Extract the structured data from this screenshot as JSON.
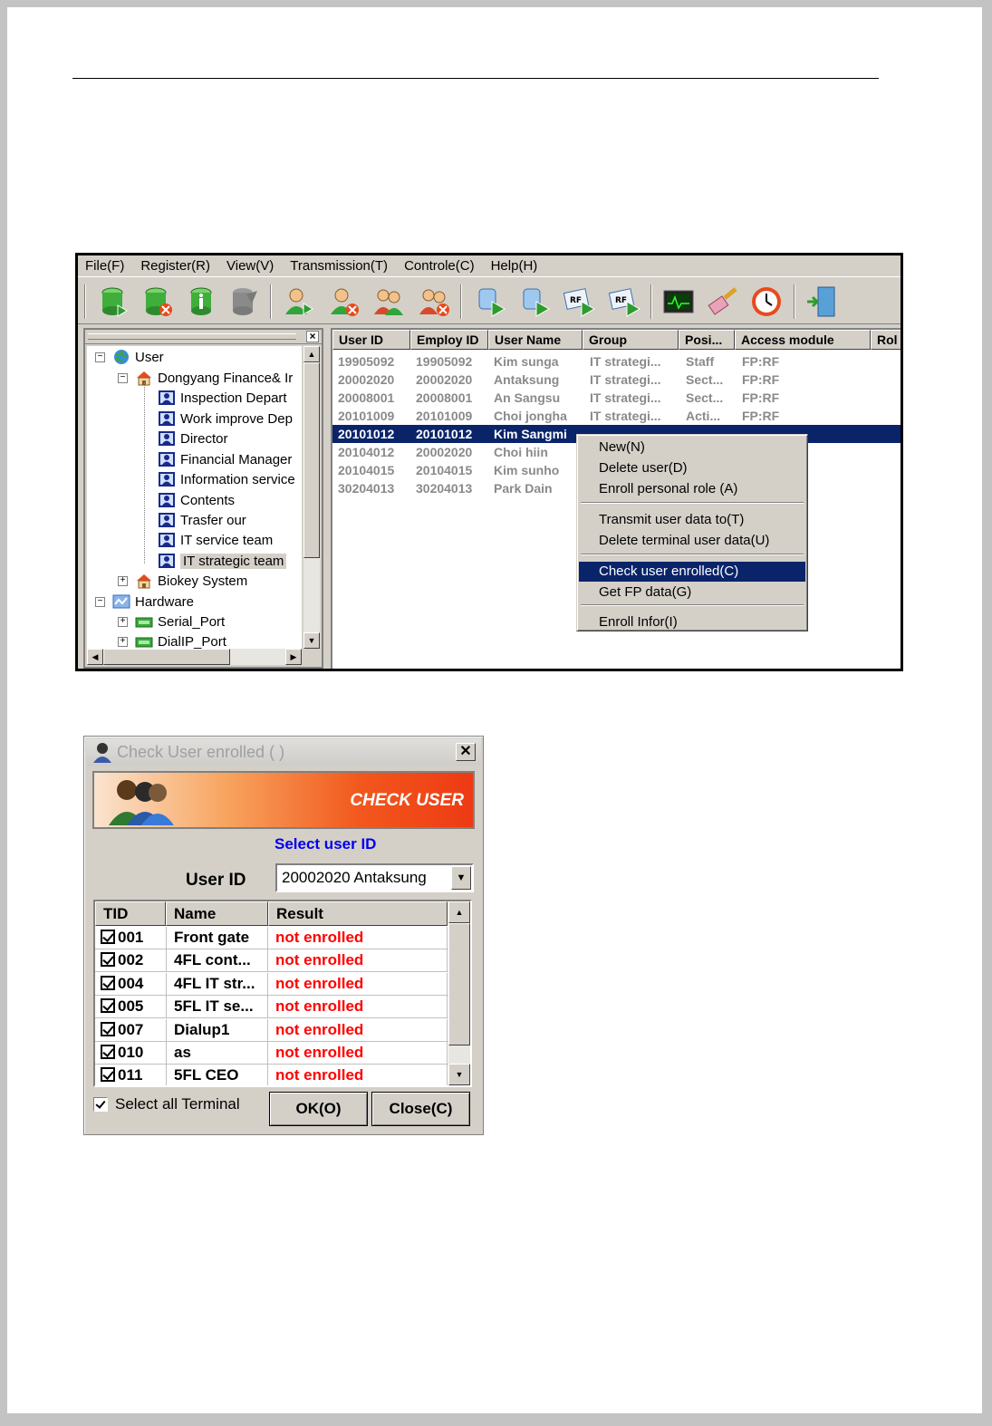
{
  "menu": [
    "File(F)",
    "Register(R)",
    "View(V)",
    "Transmission(T)",
    "Controle(C)",
    "Help(H)"
  ],
  "toolbar_icons": [
    "db-add-icon",
    "db-delete-icon",
    "db-info-icon",
    "db-disabled-icon",
    "user-add-icon",
    "user-delete-icon",
    "group-add-icon",
    "group-delete-icon",
    "fp-send-icon",
    "fp-receive-icon",
    "rf-send-icon",
    "rf-receive-icon",
    "monitor-icon",
    "clear-icon",
    "clock-icon",
    "exit-icon"
  ],
  "tree": [
    {
      "label": "User",
      "level": 0,
      "icon": "globe-icon"
    },
    {
      "label": "Dongyang Finance& Ir",
      "level": 1,
      "icon": "house-icon"
    },
    {
      "label": "Inspection Depart",
      "level": 2,
      "icon": "dept-icon"
    },
    {
      "label": "Work improve Dep",
      "level": 2,
      "icon": "dept-icon"
    },
    {
      "label": "Director",
      "level": 2,
      "icon": "dept-icon"
    },
    {
      "label": "Financial Manager",
      "level": 2,
      "icon": "dept-icon"
    },
    {
      "label": "Information service",
      "level": 2,
      "icon": "dept-icon"
    },
    {
      "label": "Contents",
      "level": 2,
      "icon": "dept-icon"
    },
    {
      "label": "Trasfer our",
      "level": 2,
      "icon": "dept-icon"
    },
    {
      "label": "IT service team",
      "level": 2,
      "icon": "dept-icon"
    },
    {
      "label": "IT strategic team",
      "level": 2,
      "icon": "dept-icon"
    },
    {
      "label": "Biokey System",
      "level": 1,
      "icon": "house-icon"
    },
    {
      "label": "Hardware",
      "level": 0,
      "icon": "network-icon"
    },
    {
      "label": "Serial_Port",
      "level": 1,
      "icon": "port-icon"
    },
    {
      "label": "DialIP_Port",
      "level": 1,
      "icon": "port-icon"
    }
  ],
  "list": {
    "columns": [
      "User ID",
      "Employ ID",
      "User Name",
      "Group",
      "Posi...",
      "Access module",
      "Rol"
    ],
    "rows": [
      [
        "19905092",
        "19905092",
        "Kim sunga",
        "IT strategi...",
        "Staff",
        "FP:RF"
      ],
      [
        "20002020",
        "20002020",
        "Antaksung",
        "IT strategi...",
        "Sect...",
        "FP:RF"
      ],
      [
        "20008001",
        "20008001",
        "An Sangsu",
        "IT strategi...",
        "Sect...",
        "FP:RF"
      ],
      [
        "20101009",
        "20101009",
        "Choi jongha",
        "IT strategi...",
        "Acti...",
        "FP:RF"
      ],
      [
        "20101012",
        "20101012",
        "Kim Sangmi",
        "",
        "",
        ""
      ],
      [
        "20104012",
        "20002020",
        "Choi hiin",
        "",
        "",
        ""
      ],
      [
        "20104015",
        "20104015",
        "Kim sunho",
        "",
        "",
        ""
      ],
      [
        "30204013",
        "30204013",
        "Park Dain",
        "",
        "",
        ""
      ]
    ],
    "selected_row": 4
  },
  "context_menu": {
    "items": [
      "New(N)",
      "Delete user(D)",
      "Enroll personal role (A)",
      "Transmit user data to(T)",
      "Delete terminal user data(U)",
      "Check user enrolled(C)",
      "Get FP data(G)",
      "Enroll Infor(I)"
    ],
    "highlighted": "Check user enrolled(C)"
  },
  "dialog": {
    "title": "Check  User enrolled ( )",
    "banner": "CHECK USER",
    "select_label": "Select user ID",
    "user_id_label": "User ID",
    "user_id_value": "20002020 Antaksung",
    "columns": [
      "TID",
      "Name",
      "Result"
    ],
    "rows": [
      [
        "001",
        "Front gate",
        "not enrolled"
      ],
      [
        "002",
        "4FL cont...",
        "not enrolled"
      ],
      [
        "004",
        "4FL IT str...",
        "not enrolled"
      ],
      [
        "005",
        "5FL IT se...",
        "not enrolled"
      ],
      [
        "007",
        "Dialup1",
        "not enrolled"
      ],
      [
        "010",
        "as",
        "not enrolled"
      ],
      [
        "011",
        "5FL CEO",
        "not enrolled"
      ]
    ],
    "select_all": "Select all Terminal",
    "ok": "OK(O)",
    "close": "Close(C)"
  },
  "colors": {
    "selection": "#0a246a",
    "not_enrolled": "#ff0000",
    "select_label": "#0000ee"
  }
}
